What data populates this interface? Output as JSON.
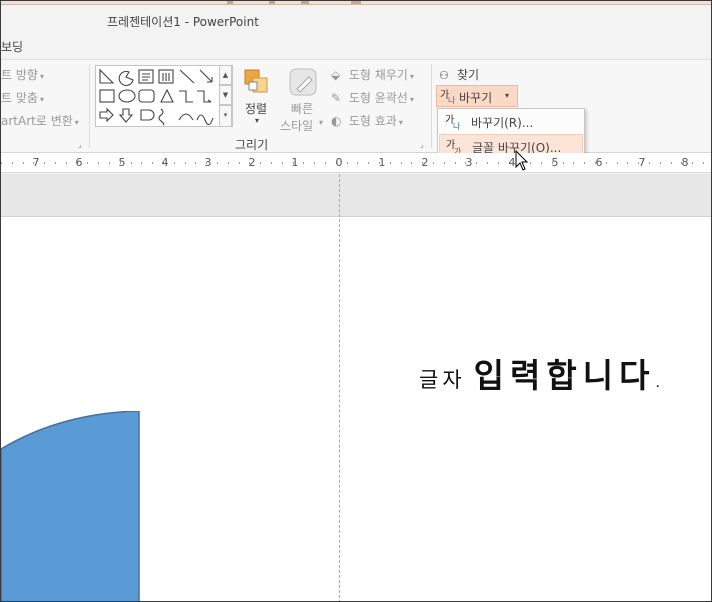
{
  "window": {
    "title": "프레젠테이션1 - PowerPoint"
  },
  "ribbon": {
    "tab_partial": "보딩",
    "left_items": [
      {
        "label": "트 방향"
      },
      {
        "label": "트 맞춤"
      },
      {
        "label": "artArt로 변환"
      }
    ],
    "drawing_group": {
      "label": "그리기",
      "arrange_label": "정렬",
      "quick_styles_line1": "빠른",
      "quick_styles_line2": "스타일",
      "shape_fill": "도형 채우기",
      "shape_outline": "도형 윤곽선",
      "shape_effects": "도형 효과"
    },
    "editing_group": {
      "find_label": "찾기",
      "replace_label": "바꾸기"
    }
  },
  "replace_menu": {
    "items": [
      {
        "label": "바꾸기(R)...",
        "hovered": false
      },
      {
        "label": "글꼴 바꾸기(O)...",
        "hovered": true
      }
    ]
  },
  "ruler": {
    "labels": [
      "7",
      "6",
      "5",
      "4",
      "3",
      "2",
      "1",
      "0",
      "1",
      "2",
      "3",
      "4",
      "5",
      "6",
      "7",
      "8"
    ]
  },
  "slide": {
    "text_small": "글자",
    "text_large": "입력합니다",
    "text_dot": ".",
    "shape_fill": "#5b9bd5",
    "shape_stroke": "#41719c"
  },
  "colors": {
    "accent_orange": "#fcd9c6",
    "menu_hover": "#fce4d8"
  }
}
